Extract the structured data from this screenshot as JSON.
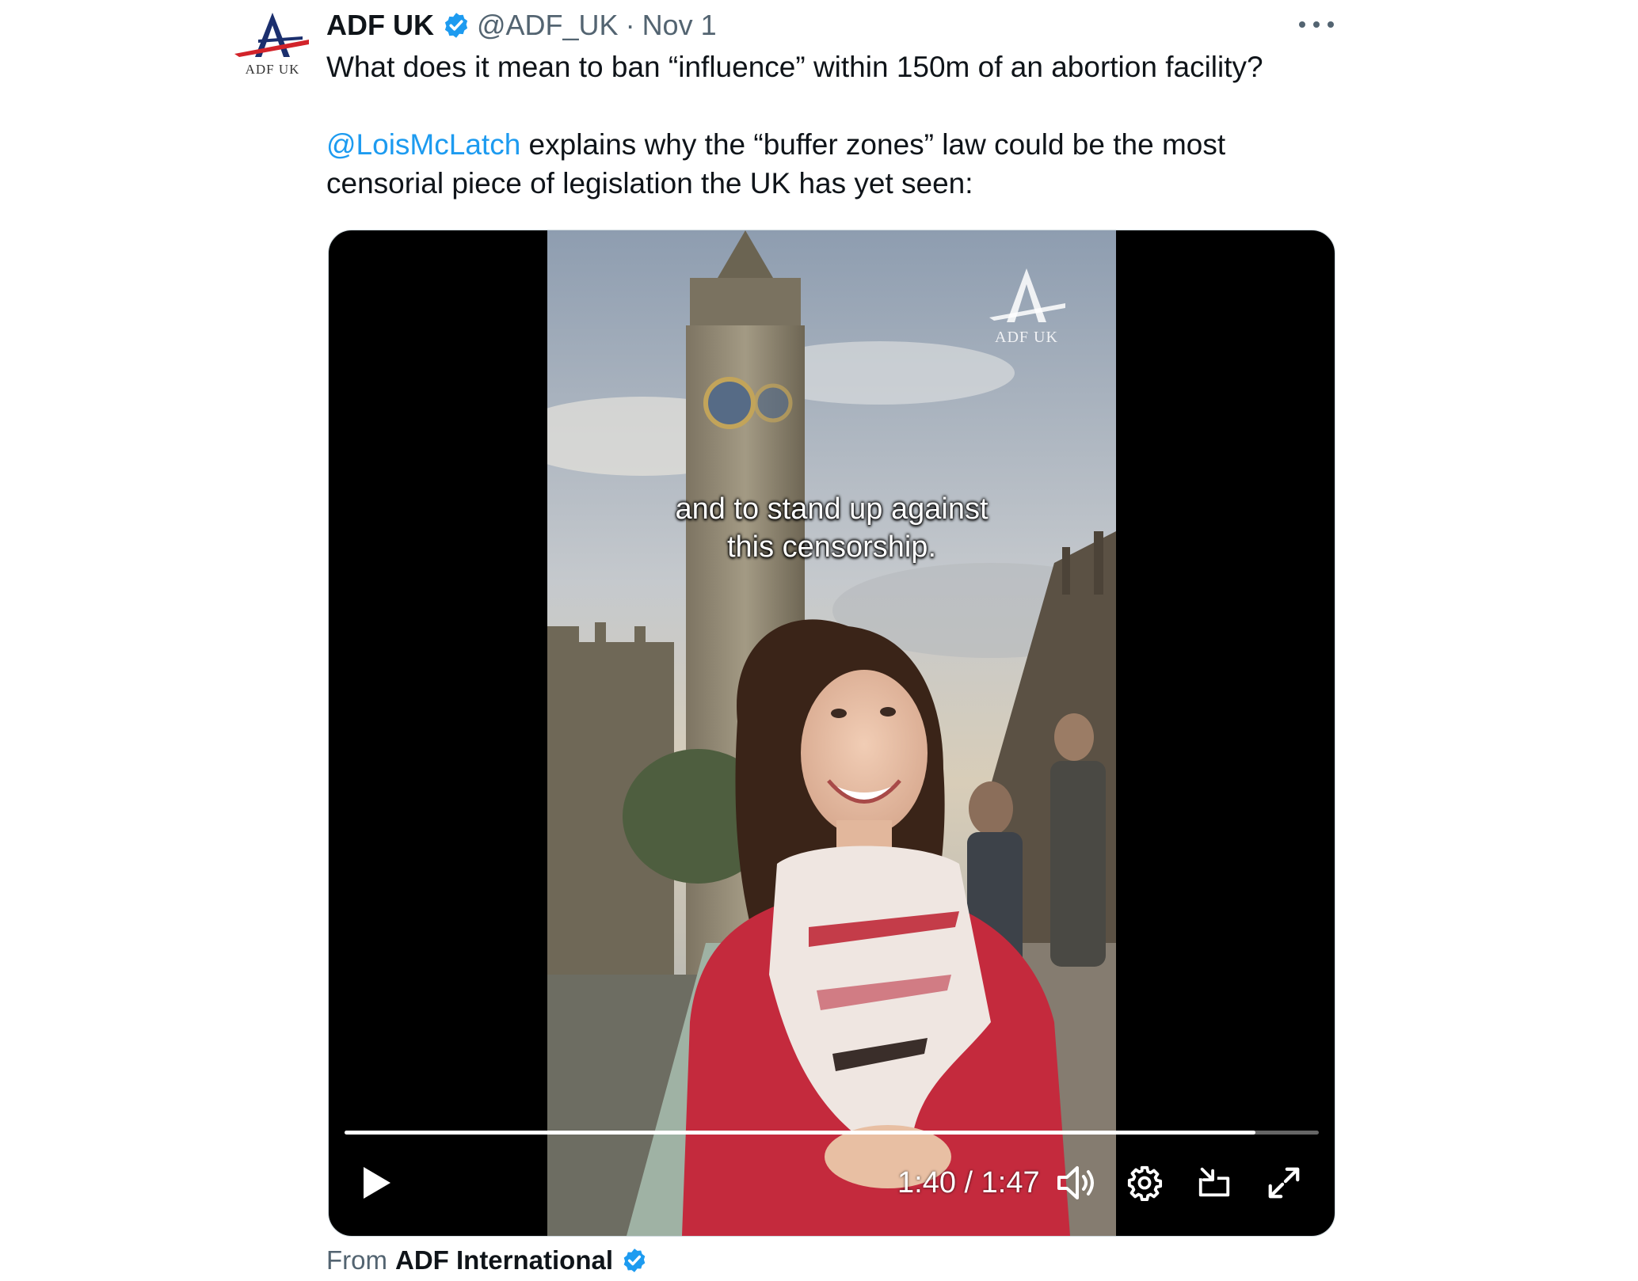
{
  "tweet": {
    "avatar": {
      "icon": "adf-uk-logo",
      "label": "ADF UK"
    },
    "display_name": "ADF UK",
    "handle": "@ADF_UK",
    "separator": "·",
    "date": "Nov 1",
    "text_line1": "What does it mean to ban “influence” within 150m of an abortion facility?",
    "mention": "@LoisMcLatch",
    "text_line2_rest": " explains why the “buffer zones” law could be the most",
    "text_line3": "censorial piece of legislation the UK has yet seen:"
  },
  "video": {
    "watermark": "ADF UK",
    "caption_line1": "and to stand up against",
    "caption_line2": "this censorship.",
    "current_time": "1:40",
    "time_separator": " / ",
    "duration": "1:47",
    "progress_fraction": 0.935,
    "controls": [
      "play-icon",
      "volume-icon",
      "settings-gear-icon",
      "dock-icon",
      "fullscreen-icon"
    ]
  },
  "footer": {
    "from_label": "From",
    "from_name": "ADF International"
  },
  "colors": {
    "link": "#1d9bf0",
    "verified": "#1d9bf0",
    "muted": "#536471"
  }
}
